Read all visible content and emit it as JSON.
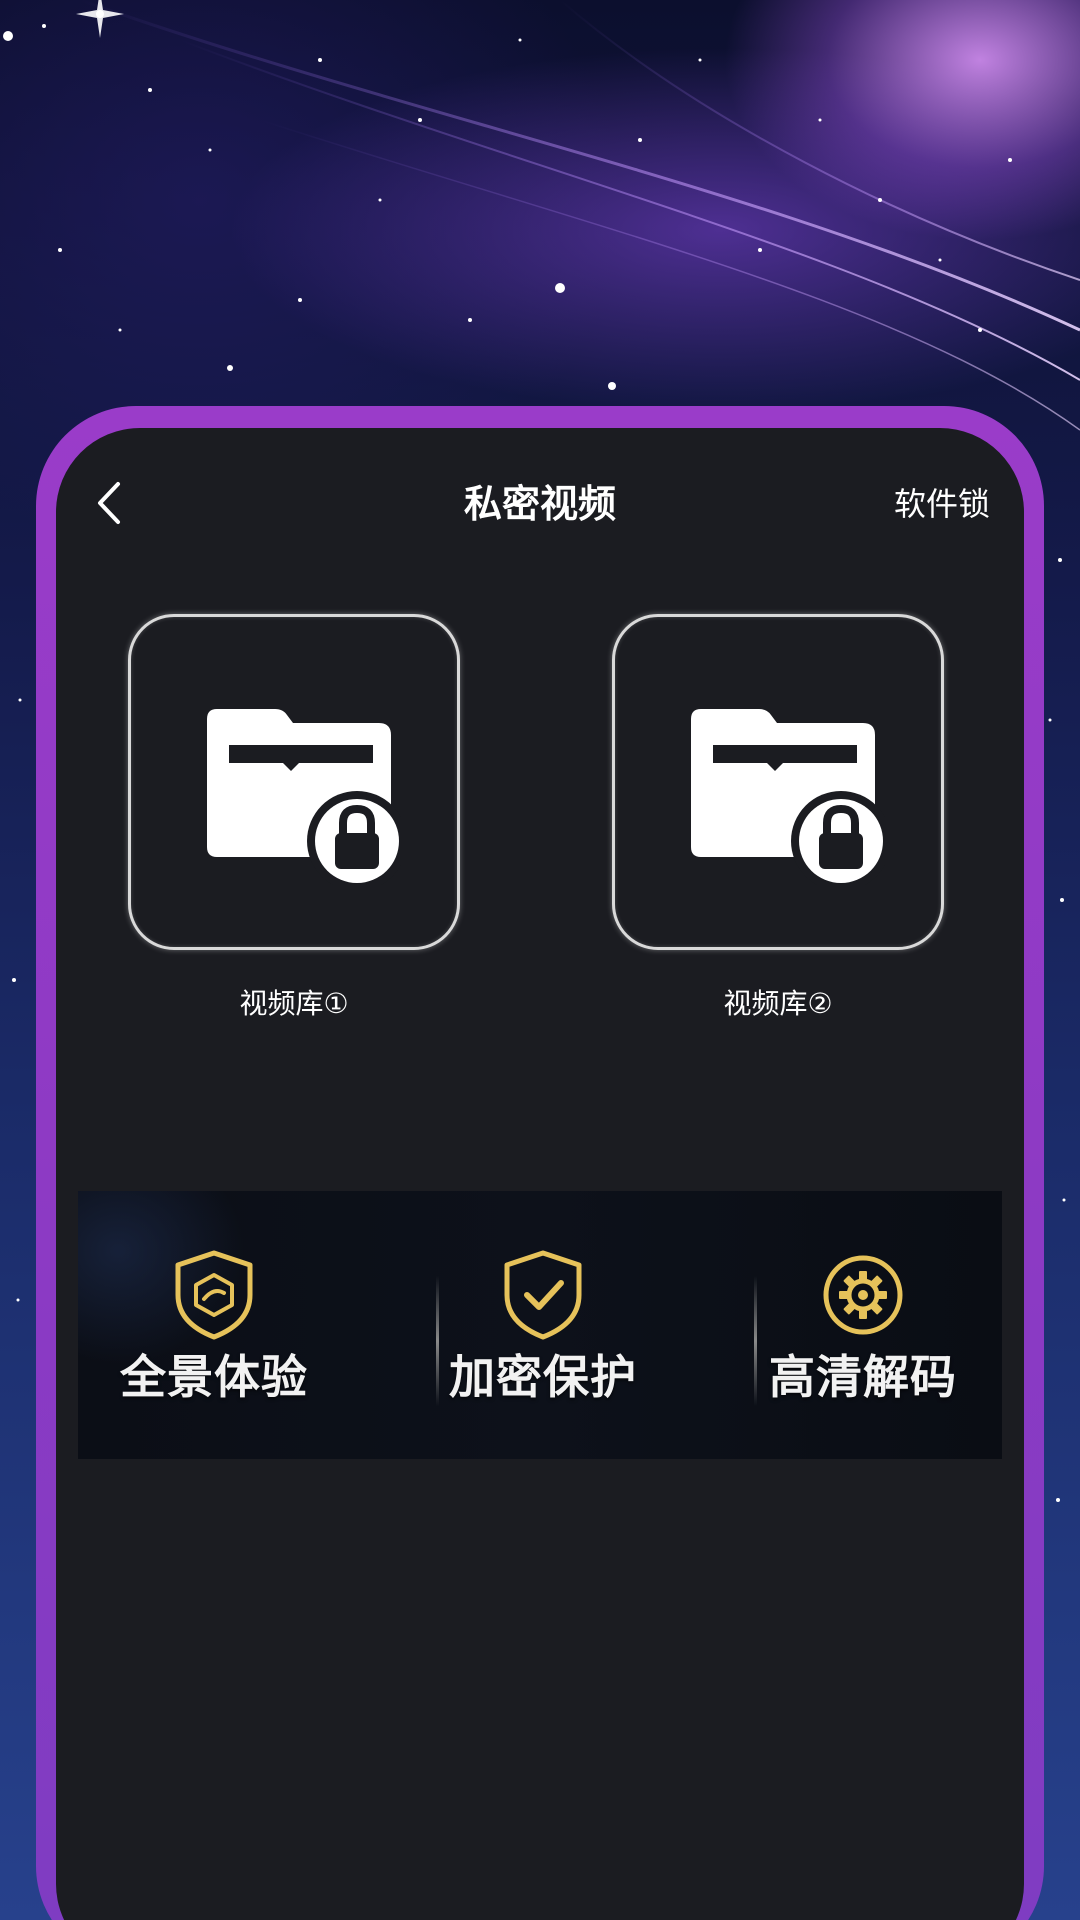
{
  "header": {
    "title": "私密视频",
    "right_action": "软件锁"
  },
  "libraries": [
    {
      "label": "视频库①",
      "icon": "folder-lock-icon"
    },
    {
      "label": "视频库②",
      "icon": "folder-lock-icon"
    }
  ],
  "features": [
    {
      "label": "全景体验",
      "icon": "shield-icon"
    },
    {
      "label": "加密保护",
      "icon": "shield-check-icon"
    },
    {
      "label": "高清解码",
      "icon": "gear-icon"
    }
  ],
  "colors": {
    "accent_gold": "#e6c25a",
    "frame_purple": "#9a3cc9",
    "panel_dark": "#1b1c21"
  }
}
